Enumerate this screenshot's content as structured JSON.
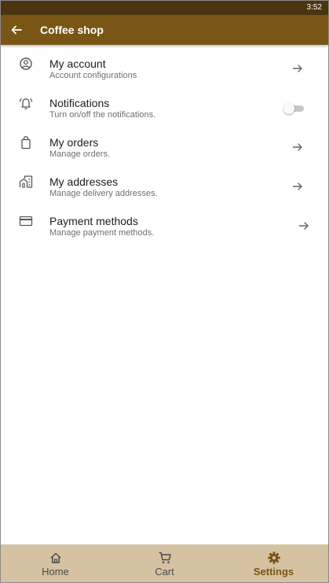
{
  "status_bar": {
    "time": "3:52"
  },
  "app_bar": {
    "title": "Coffee shop",
    "back_icon": "arrow-left-icon"
  },
  "colors": {
    "status_bar": "#4a3510",
    "app_bar": "#7a5616",
    "bottom_nav": "#d4c2a2",
    "active_nav": "#7a5616"
  },
  "settings": [
    {
      "title": "My account",
      "subtitle": "Account configurations",
      "icon": "account-circle-icon",
      "trailing": "arrow"
    },
    {
      "title": "Notifications",
      "subtitle": "Turn on/off the notifications.",
      "icon": "bell-icon",
      "trailing": "toggle",
      "enabled": false
    },
    {
      "title": "My orders",
      "subtitle": "Manage orders.",
      "icon": "shopping-bag-icon",
      "trailing": "arrow"
    },
    {
      "title": "My addresses",
      "subtitle": "Manage delivery addresses.",
      "icon": "home-building-icon",
      "trailing": "arrow"
    },
    {
      "title": "Payment methods",
      "subtitle": "Manage payment methods.",
      "icon": "credit-card-icon",
      "trailing": "arrow"
    }
  ],
  "bottom_nav": [
    {
      "label": "Home",
      "icon": "home-icon",
      "active": false
    },
    {
      "label": "Cart",
      "icon": "cart-icon",
      "active": false
    },
    {
      "label": "Settings",
      "icon": "gear-icon",
      "active": true
    }
  ]
}
